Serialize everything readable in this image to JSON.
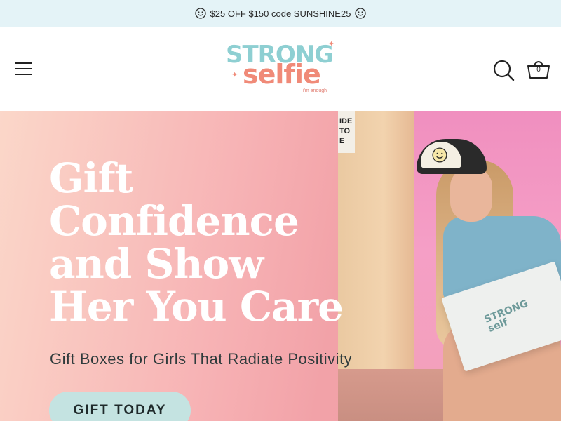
{
  "announcement": {
    "text": "$25 OFF $150 code SUNSHINE25",
    "left_icon": "smiley-icon",
    "right_icon": "smiley-icon"
  },
  "header": {
    "menu_icon": "hamburger-menu-icon",
    "logo": {
      "line1": "STRONG",
      "line2": "selfie",
      "tagline": "i'm enough"
    },
    "search_icon": "search-icon",
    "cart_icon": "basket-icon",
    "cart_count": "0"
  },
  "hero": {
    "title_lines": [
      "Gift",
      "Confidence",
      "and Show",
      "Her You Care"
    ],
    "subtitle": "Gift Boxes for Girls That Radiate Positivity",
    "cta_label": "GIFT TODAY",
    "sign_text": "IDE\nTO\nE",
    "box_logo_line1": "STRONG",
    "box_logo_line2": "self"
  },
  "colors": {
    "announcement_bg": "#e4f3f7",
    "logo_teal": "#8ecfd2",
    "logo_coral": "#f08a78",
    "hero_pink": "#f2a2a8",
    "cta_bg": "#c4e3e1",
    "cta_text": "#1f2a2b"
  }
}
